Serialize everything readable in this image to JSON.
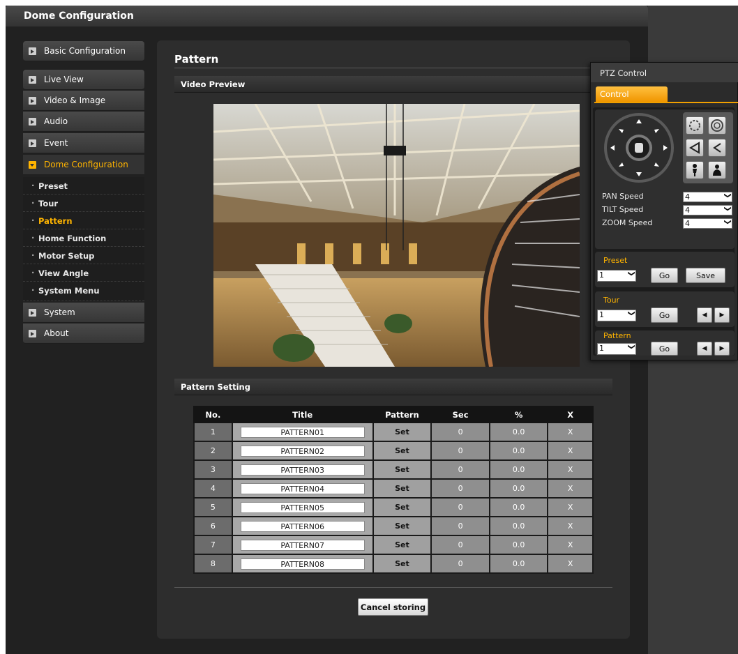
{
  "window": {
    "title": "Dome Configuration"
  },
  "sidebar": {
    "top_items": [
      {
        "label": "Basic Configuration"
      },
      {
        "label": "Live View"
      },
      {
        "label": "Video & Image"
      },
      {
        "label": "Audio"
      },
      {
        "label": "Event"
      },
      {
        "label": "Dome Configuration",
        "active": true
      }
    ],
    "sub_items": [
      {
        "label": "Preset"
      },
      {
        "label": "Tour"
      },
      {
        "label": "Pattern",
        "active": true
      },
      {
        "label": "Home Function"
      },
      {
        "label": "Motor Setup"
      },
      {
        "label": "View Angle"
      },
      {
        "label": "System Menu"
      }
    ],
    "bottom_items": [
      {
        "label": "System"
      },
      {
        "label": "About"
      }
    ]
  },
  "main": {
    "page_title": "Pattern",
    "video_section": "Video Preview",
    "pattern_section": "Pattern Setting",
    "table": {
      "headers": [
        "No.",
        "Title",
        "Pattern",
        "Sec",
        "%",
        "X"
      ],
      "rows": [
        {
          "no": "1",
          "title": "PATTERN01",
          "pattern": "Set",
          "sec": "0",
          "pct": "0.0",
          "x": "X"
        },
        {
          "no": "2",
          "title": "PATTERN02",
          "pattern": "Set",
          "sec": "0",
          "pct": "0.0",
          "x": "X"
        },
        {
          "no": "3",
          "title": "PATTERN03",
          "pattern": "Set",
          "sec": "0",
          "pct": "0.0",
          "x": "X"
        },
        {
          "no": "4",
          "title": "PATTERN04",
          "pattern": "Set",
          "sec": "0",
          "pct": "0.0",
          "x": "X"
        },
        {
          "no": "5",
          "title": "PATTERN05",
          "pattern": "Set",
          "sec": "0",
          "pct": "0.0",
          "x": "X"
        },
        {
          "no": "6",
          "title": "PATTERN06",
          "pattern": "Set",
          "sec": "0",
          "pct": "0.0",
          "x": "X"
        },
        {
          "no": "7",
          "title": "PATTERN07",
          "pattern": "Set",
          "sec": "0",
          "pct": "0.0",
          "x": "X"
        },
        {
          "no": "8",
          "title": "PATTERN08",
          "pattern": "Set",
          "sec": "0",
          "pct": "0.0",
          "x": "X"
        }
      ]
    },
    "cancel_label": "Cancel storing"
  },
  "ptz": {
    "title": "PTZ Control",
    "tab": "Control",
    "pan_label": "PAN Speed",
    "pan_value": "4",
    "tilt_label": "TILT Speed",
    "tilt_value": "4",
    "zoom_label": "ZOOM Speed",
    "zoom_value": "4",
    "preset_label": "Preset",
    "preset_value": "1",
    "preset_go": "Go",
    "preset_save": "Save",
    "tour_label": "Tour",
    "tour_value": "1",
    "tour_go": "Go",
    "pattern_label": "Pattern",
    "pattern_value": "1",
    "pattern_go": "Go",
    "prev_glyph": "◀",
    "next_glyph": "▶"
  },
  "colors": {
    "accent": "#ffb400",
    "panel": "#2d2d2d",
    "background": "#262626"
  }
}
